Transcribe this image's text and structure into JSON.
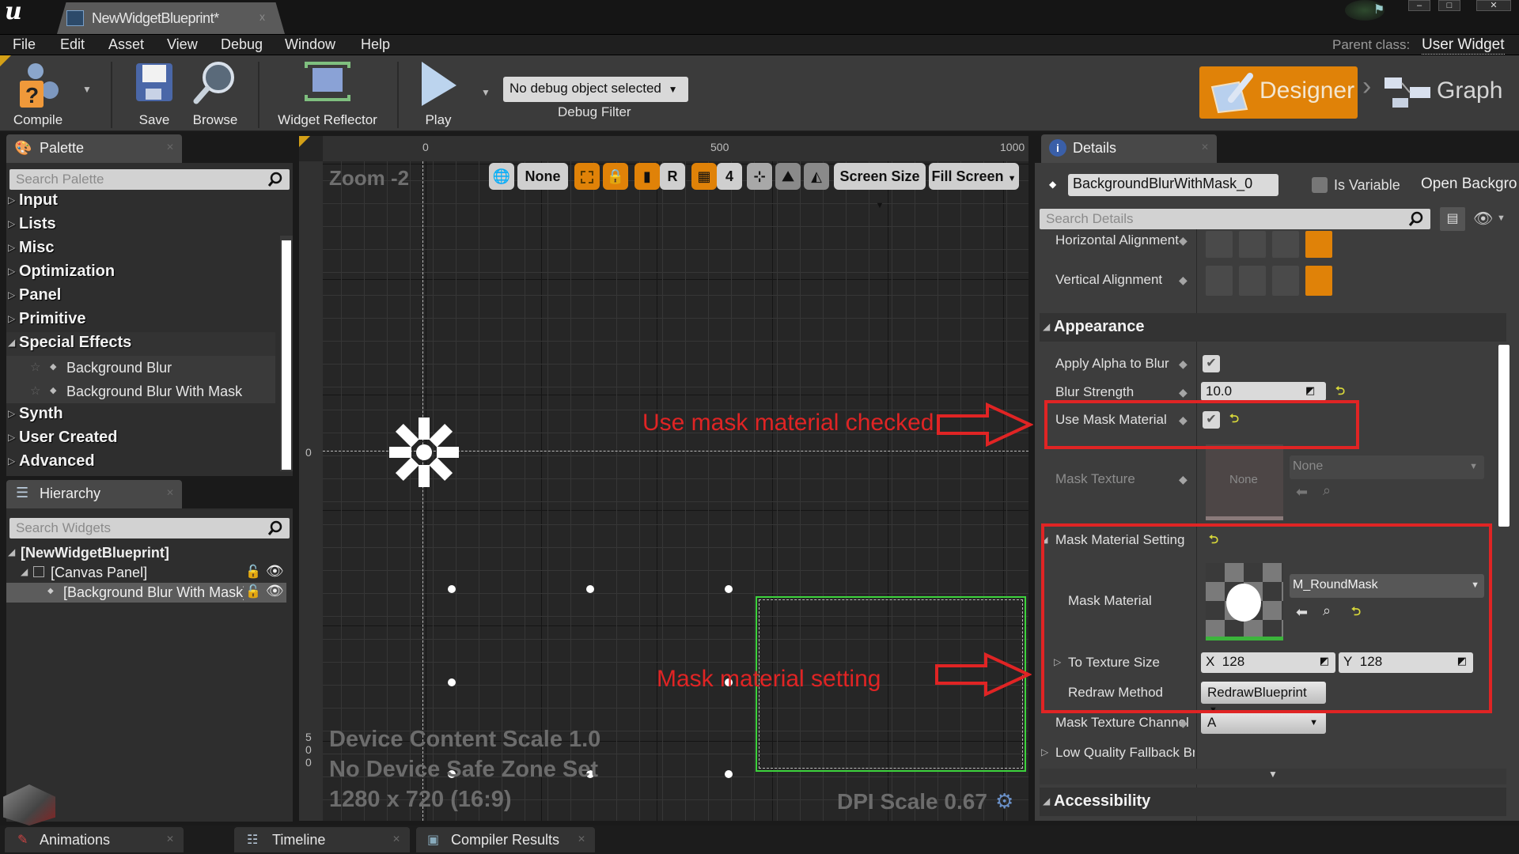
{
  "titlebar": {
    "tab_title": "NewWidgetBlueprint*",
    "close_glyph": "x"
  },
  "menubar": {
    "items": [
      "File",
      "Edit",
      "Asset",
      "View",
      "Debug",
      "Window",
      "Help"
    ],
    "parent_class_label": "Parent class:",
    "parent_class_value": "User Widget"
  },
  "toolbar": {
    "compile": "Compile",
    "save": "Save",
    "browse": "Browse",
    "widget_reflector": "Widget Reflector",
    "play": "Play",
    "debug_object": "No debug object selected",
    "debug_filter": "Debug Filter",
    "designer": "Designer",
    "graph": "Graph"
  },
  "palette": {
    "title": "Palette",
    "search_placeholder": "Search Palette",
    "categories": [
      {
        "label": "Input",
        "expanded": false
      },
      {
        "label": "Lists",
        "expanded": false
      },
      {
        "label": "Misc",
        "expanded": false
      },
      {
        "label": "Optimization",
        "expanded": false
      },
      {
        "label": "Panel",
        "expanded": false
      },
      {
        "label": "Primitive",
        "expanded": false
      },
      {
        "label": "Special Effects",
        "expanded": true
      },
      {
        "label": "Synth",
        "expanded": false
      },
      {
        "label": "User Created",
        "expanded": false
      },
      {
        "label": "Advanced",
        "expanded": false
      }
    ],
    "special_effects_items": [
      "Background Blur",
      "Background Blur With Mask"
    ]
  },
  "hierarchy": {
    "title": "Hierarchy",
    "search_placeholder": "Search Widgets",
    "rows": [
      "[NewWidgetBlueprint]",
      "[Canvas Panel]",
      "[Background Blur With Mask]"
    ]
  },
  "canvas": {
    "zoom_label": "Zoom -2",
    "ruler_top": [
      "0",
      "500",
      "1000"
    ],
    "ruler_left": [
      "0",
      "5",
      "0",
      "0"
    ],
    "toolbar": {
      "none_label": "None",
      "r_label": "R",
      "grid_snap": "4",
      "screen_size": "Screen Size",
      "fill_screen": "Fill Screen"
    },
    "info_lines": [
      "Device Content Scale 1.0",
      "No Device Safe Zone Set",
      "1280 x 720 (16:9)"
    ],
    "dpi_scale": "DPI Scale 0.67"
  },
  "annotations": {
    "use_mask": "Use mask material checked",
    "mask_setting": "Mask material setting",
    "color": "#e02424"
  },
  "details": {
    "title": "Details",
    "widget_name": "BackgroundBlurWithMask_0",
    "is_variable_label": "Is Variable",
    "is_variable_checked": false,
    "open_background": "Open Backgro",
    "search_placeholder": "Search Details",
    "horizontal_alignment": "Horizontal Alignment",
    "vertical_alignment": "Vertical Alignment",
    "appearance_header": "Appearance",
    "apply_alpha_label": "Apply Alpha to Blur",
    "apply_alpha_checked": true,
    "blur_strength_label": "Blur Strength",
    "blur_strength_value": "10.0",
    "use_mask_label": "Use Mask Material",
    "use_mask_checked": true,
    "mask_texture_label": "Mask Texture",
    "mask_texture_thumb": "None",
    "mask_texture_value": "None",
    "mask_setting_header": "Mask Material Setting",
    "mask_material_label": "Mask Material",
    "mask_material_value": "M_RoundMask",
    "to_texture_size_label": "To Texture Size",
    "texture_x_label": "X",
    "texture_x_value": "128",
    "texture_y_label": "Y",
    "texture_y_value": "128",
    "redraw_method_label": "Redraw Method",
    "redraw_method_value": "RedrawBlueprint",
    "mask_channel_label": "Mask Texture Channel",
    "mask_channel_value": "A",
    "low_quality_label": "Low Quality Fallback Bru",
    "accessibility_header": "Accessibility"
  },
  "bottom_tabs": [
    "Animations",
    "Timeline",
    "Compiler Results"
  ],
  "colors": {
    "accent_orange": "#e08208",
    "selection_green": "#3cd23c"
  }
}
